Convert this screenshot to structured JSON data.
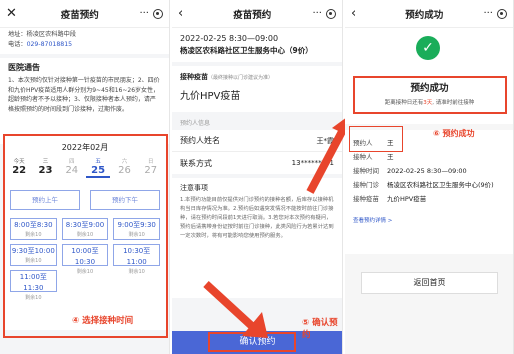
{
  "p1": {
    "nav_title": "疫苗预约",
    "address": "地址：杨凌区农科路中段",
    "phone_label": "电话：",
    "phone": "029-87018815",
    "notice_title": "医院通告",
    "notice_text": "1、本次预约仅针对接种第一针疫苗的市民朋友；2、四价和九价HPV疫苗适用人群分别为9~45和16~26岁女性，超龄预约者不予以接种；3、仅限接种者本人预约，请严格按照预约的时间段到门诊接种，过期作废。",
    "month": "2022年02月",
    "days": [
      {
        "w": "今天",
        "d": "22"
      },
      {
        "w": "三",
        "d": "23"
      },
      {
        "w": "四",
        "d": "24"
      },
      {
        "w": "五",
        "d": "25"
      },
      {
        "w": "六",
        "d": "26"
      },
      {
        "w": "日",
        "d": "27"
      }
    ],
    "am_label": "预约上午",
    "pm_label": "预约下午",
    "slots": [
      {
        "t": "8:00至8:30",
        "s": "剩余10"
      },
      {
        "t": "8:30至9:00",
        "s": "剩余10"
      },
      {
        "t": "9:00至9:30",
        "s": "剩余10"
      },
      {
        "t": "9:30至10:00",
        "s": "剩余10"
      },
      {
        "t": "10:00至10:30",
        "s": "剩余10"
      },
      {
        "t": "10:30至11:00",
        "s": "剩余10"
      },
      {
        "t": "11:00至11:30",
        "s": "剩余10"
      }
    ],
    "step_label": "④ 选择接种时间"
  },
  "p2": {
    "nav_title": "疫苗预约",
    "datetime": "2022-02-25 8:30—09:00",
    "center": "杨凌区农科路社区卫生服务中心（9价）",
    "vaccine_section": "接种疫苗",
    "vaccine_hint": "（最终接种以门诊建议为准）",
    "vaccine_name": "九价HPV疫苗",
    "person_section": "预约人信息",
    "name_label": "预约人姓名",
    "name_value": "王*霞",
    "phone_label": "联系方式",
    "phone_value": "13*******91",
    "notes_title": "注意事项",
    "notes_text": "1.本预约功能目前仅提供对门诊预约的接种名额，后库存以接种机构当日库存情况为准。2.预约后如遇突发情况不能按时前往门诊接种，请在预约时间段前1天进行取消。3.若您对本次预约有疑问，预约后请携带身份证按时前往门诊接种，此类风险行为若累计达到一定次数时，将有可能影响您使用预约服务。",
    "confirm_button": "确认预约",
    "step_label": "⑤ 确认预约"
  },
  "p3": {
    "nav_title": "预约成功",
    "success_title": "预约成功",
    "success_sub_pre": "距离接种日还有",
    "success_days": "3天",
    "success_sub_post": ", 请准时前往接种",
    "step_label": "⑥ 预约成功",
    "details": [
      {
        "k": "预约人",
        "v": "王"
      },
      {
        "k": "接种人",
        "v": "王"
      },
      {
        "k": "接种时间",
        "v": "2022-02-25 8:30—09:00"
      },
      {
        "k": "接种门诊",
        "v": "杨凌区农科路社区卫生服务中心(9价)"
      },
      {
        "k": "接种疫苗",
        "v": "九价HPV疫苗"
      }
    ],
    "detail_link": "查看预约详情 >",
    "home_button": "返回首页"
  },
  "colors": {
    "accent": "#4a67d6",
    "annotation": "#e8452c",
    "success": "#1aad5a"
  }
}
